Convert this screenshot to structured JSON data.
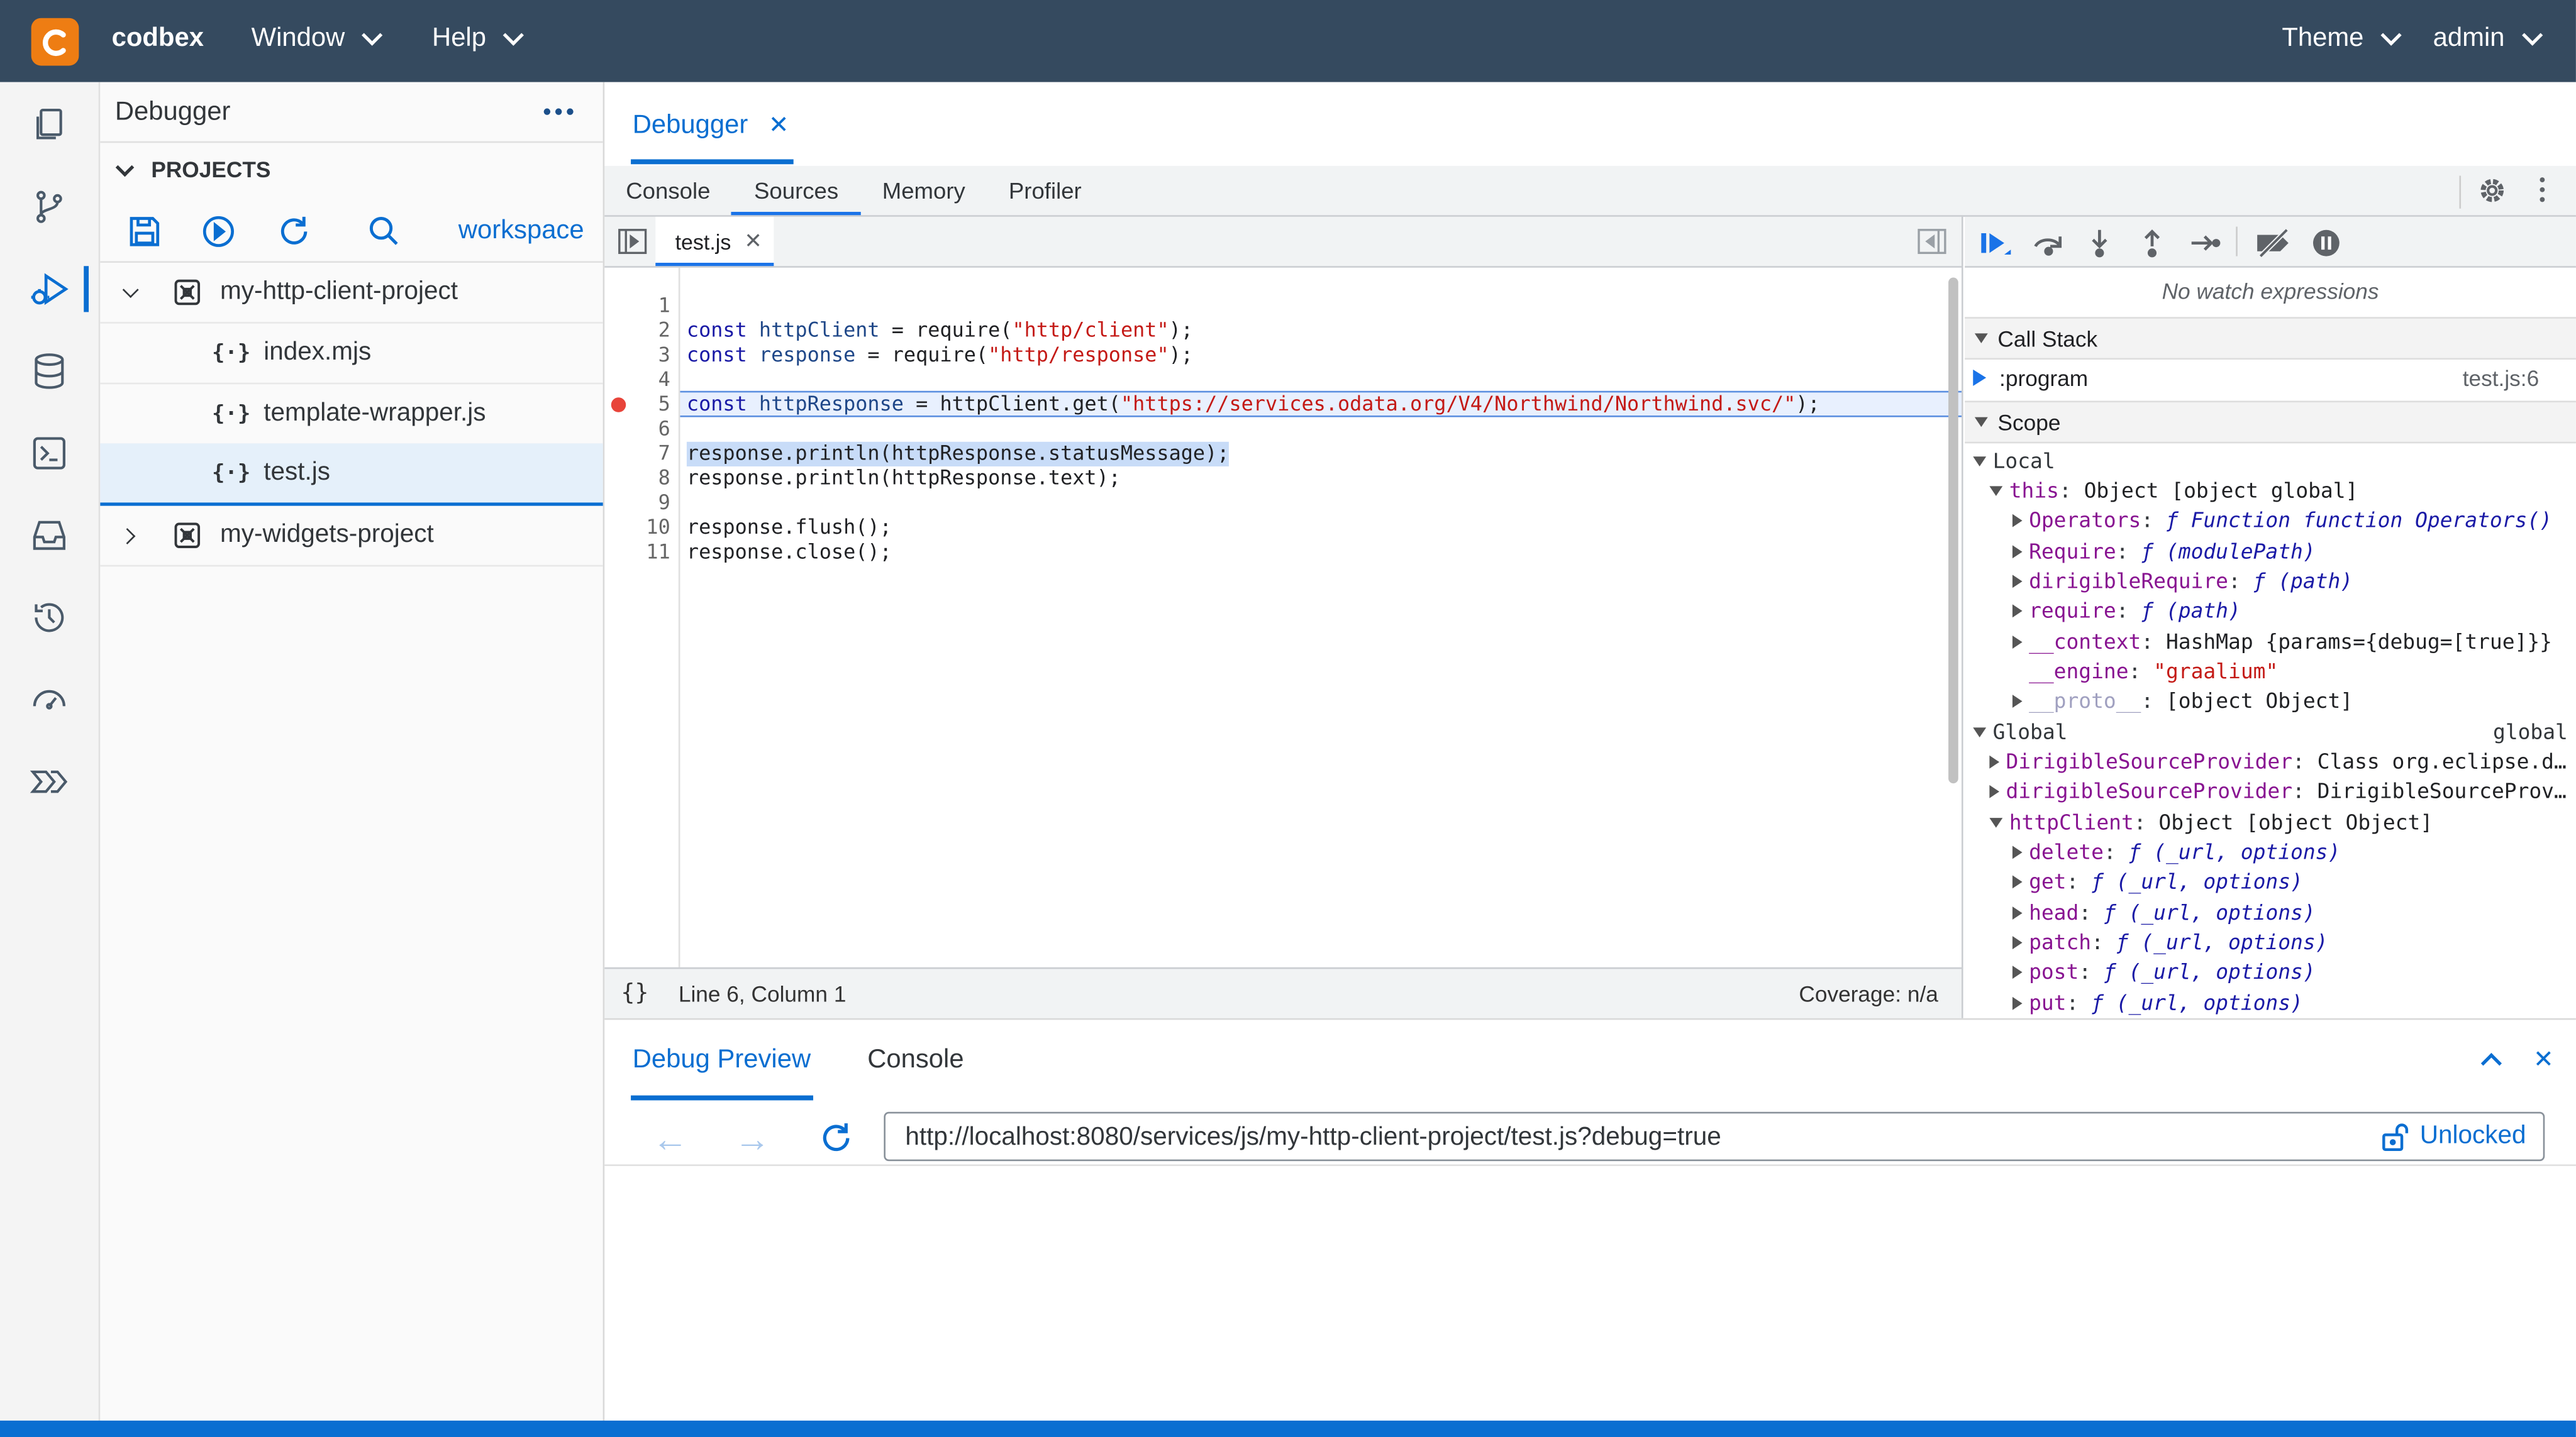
{
  "topbar": {
    "brand": "codbex",
    "menu_window": "Window",
    "menu_help": "Help",
    "menu_theme": "Theme",
    "user": "admin"
  },
  "explorer": {
    "title": "Debugger",
    "section": "PROJECTS",
    "workspace": "workspace",
    "projects": [
      {
        "name": "my-http-client-project",
        "files": [
          "index.mjs",
          "template-wrapper.js",
          "test.js"
        ]
      },
      {
        "name": "my-widgets-project"
      }
    ]
  },
  "editor_tab": "Debugger",
  "devtools": {
    "tabs": [
      "Console",
      "Sources",
      "Memory",
      "Profiler"
    ],
    "file_tab": "test.js",
    "status_position": "Line 6, Column 1",
    "status_coverage": "Coverage: n/a",
    "code": {
      "l1": {
        "a": "const ",
        "b": "httpClient",
        "c": " = require(",
        "d": "\"http/client\"",
        "e": ");"
      },
      "l2": {
        "a": "const ",
        "b": "response",
        "c": " = require(",
        "d": "\"http/response\"",
        "e": ");"
      },
      "l4": {
        "a": "const ",
        "b": "httpResponse",
        "c": " = httpClient.get(",
        "d": "\"https://services.odata.org/V4/Northwind/Northwind.svc/\"",
        "e": ");"
      },
      "l6": "response.println(httpResponse.statusMessage);",
      "l7": "response.println(httpResponse.text);",
      "l9": "response.flush();",
      "l10": "response.close();"
    },
    "line_numbers": [
      "1",
      "2",
      "3",
      "4",
      "5",
      "6",
      "7",
      "8",
      "9",
      "10",
      "11"
    ],
    "watch_empty": "No watch expressions",
    "call_stack_title": "Call Stack",
    "call_stack": {
      "frame": ":program",
      "location": "test.js:6"
    },
    "scope_title": "Scope",
    "scope": {
      "local": "Local",
      "this_key": "this",
      "this_val": "Object [object global]",
      "operators_key": "Operators",
      "operators_val": "ƒ Function function Operators()",
      "require_cap_key": "Require",
      "require_cap_val": "ƒ (modulePath)",
      "dirigible_req_key": "dirigibleRequire",
      "dirigible_req_val": "ƒ (path)",
      "require_key": "require",
      "require_val": "ƒ (path)",
      "context_key": "__context",
      "context_val": "HashMap {params={debug=[true]}}",
      "engine_key": "__engine",
      "engine_val": "\"graalium\"",
      "proto_key": "__proto__",
      "proto_val": "[object Object]",
      "global": "Global",
      "global_val": "global",
      "dsp_cap_key": "DirigibleSourceProvider",
      "dsp_cap_val": "Class org.eclipse.d…",
      "dsp_key": "dirigibleSourceProvider",
      "dsp_val": "DirigibleSourceProv…",
      "httpclient_key": "httpClient",
      "httpclient_val": "Object [object Object]",
      "delete_key": "delete",
      "delete_val": "ƒ (_url, options)",
      "get_key": "get",
      "get_val": "ƒ (_url, options)",
      "head_key": "head",
      "head_val": "ƒ (_url, options)",
      "patch_key": "patch",
      "patch_val": "ƒ (_url, options)",
      "post_key": "post",
      "post_val": "ƒ (_url, options)",
      "put_key": "put",
      "put_val": "ƒ (_url, options)"
    }
  },
  "bottom": {
    "tab_preview": "Debug Preview",
    "tab_console": "Console",
    "url": "http://localhost:8080/services/js/my-http-client-project/test.js?debug=true",
    "lock_label": "Unlocked"
  },
  "colors": {
    "topbar": "#354a5f",
    "accent": "#0a6ed1",
    "logo": "#ee7d13"
  }
}
